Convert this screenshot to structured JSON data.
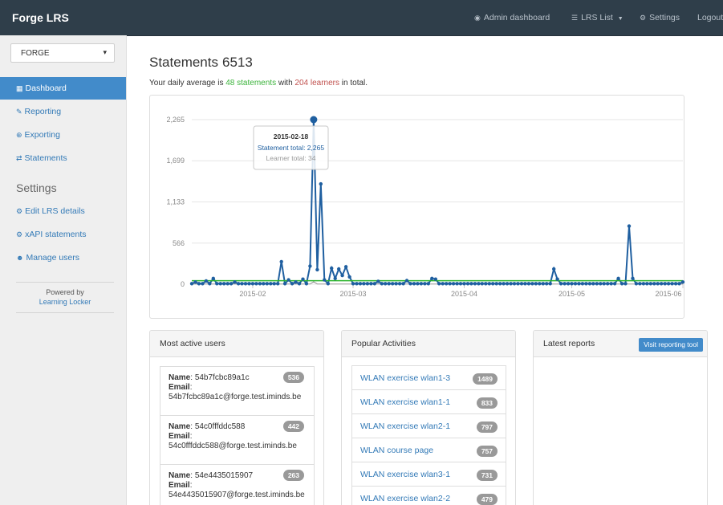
{
  "navbar": {
    "brand": "Forge LRS",
    "admin_dashboard": "Admin dashboard",
    "lrs_list": "LRS List",
    "settings": "Settings",
    "logout": "Logout"
  },
  "sidebar": {
    "lrs_select": "FORGE",
    "items": [
      {
        "label": "Dashboard",
        "icon": "bar-chart-icon"
      },
      {
        "label": "Reporting",
        "icon": "pencil-icon"
      },
      {
        "label": "Exporting",
        "icon": "download-circle-icon"
      },
      {
        "label": "Statements",
        "icon": "transfer-icon"
      }
    ],
    "settings_heading": "Settings",
    "settings_items": [
      {
        "label": "Edit LRS details",
        "icon": "gear-icon"
      },
      {
        "label": "xAPI statements",
        "icon": "gears-icon"
      },
      {
        "label": "Manage users",
        "icon": "users-icon"
      }
    ],
    "powered_by": "Powered by",
    "powered_link": "Learning Locker"
  },
  "main": {
    "title": "Statements",
    "statement_count": "6513",
    "summary": {
      "prefix": "Your daily average is",
      "statements": "48 statements",
      "middle": "with",
      "learners": "204 learners",
      "suffix": "in total."
    }
  },
  "chart_data": {
    "type": "line",
    "y_ticks": [
      "2,265",
      "1,699",
      "1,133",
      "566",
      "0"
    ],
    "x_ticks": [
      "2015-02",
      "2015-03",
      "2015-04",
      "2015-05",
      "2015-06"
    ],
    "ylim": [
      0,
      2265
    ],
    "grid": true,
    "series": [
      {
        "name": "Statement total",
        "color": "#1f5fa0",
        "points": [
          [
            "2015-01-16",
            30
          ],
          [
            "2015-01-19",
            45
          ],
          [
            "2015-01-21",
            80
          ],
          [
            "2015-01-27",
            30
          ],
          [
            "2015-02-09",
            310
          ],
          [
            "2015-02-11",
            60
          ],
          [
            "2015-02-13",
            30
          ],
          [
            "2015-02-15",
            70
          ],
          [
            "2015-02-17",
            250
          ],
          [
            "2015-02-18",
            2265
          ],
          [
            "2015-02-19",
            200
          ],
          [
            "2015-02-20",
            1380
          ],
          [
            "2015-02-21",
            60
          ],
          [
            "2015-02-23",
            220
          ],
          [
            "2015-02-24",
            80
          ],
          [
            "2015-02-25",
            210
          ],
          [
            "2015-02-26",
            120
          ],
          [
            "2015-02-27",
            240
          ],
          [
            "2015-02-28",
            100
          ],
          [
            "2015-03-08",
            40
          ],
          [
            "2015-03-16",
            50
          ],
          [
            "2015-03-23",
            80
          ],
          [
            "2015-03-24",
            70
          ],
          [
            "2015-04-26",
            210
          ],
          [
            "2015-04-27",
            70
          ],
          [
            "2015-05-14",
            80
          ],
          [
            "2015-05-17",
            800
          ],
          [
            "2015-05-18",
            80
          ],
          [
            "2015-06-01",
            30
          ]
        ]
      },
      {
        "name": "Learner total",
        "color": "#999999",
        "points": [
          [
            "2015-02-18",
            34
          ]
        ]
      },
      {
        "name": "Daily average",
        "color": "#2db52d",
        "points": [
          [
            "2015-01-15",
            48
          ],
          [
            "2015-06-01",
            48
          ]
        ]
      }
    ],
    "tooltip": {
      "date": "2015-02-18",
      "statement_label": "Statement total: 2,265",
      "learner_label": "Learner total: 34"
    }
  },
  "panels": {
    "most_active": {
      "title": "Most active users",
      "name_label": "Name",
      "email_label": "Email",
      "users": [
        {
          "name": "54b7fcbc89a1c",
          "email": "54b7fcbc89a1c@forge.test.iminds.be",
          "count": "536"
        },
        {
          "name": "54c0fffddc588",
          "email": "54c0fffddc588@forge.test.iminds.be",
          "count": "442"
        },
        {
          "name": "54e4435015907",
          "email": "54e4435015907@forge.test.iminds.be",
          "count": "263"
        }
      ]
    },
    "popular": {
      "title": "Popular Activities",
      "activities": [
        {
          "label": "WLAN exercise wlan1-3",
          "count": "1489"
        },
        {
          "label": "WLAN exercise wlan1-1",
          "count": "833"
        },
        {
          "label": "WLAN exercise wlan2-1",
          "count": "797"
        },
        {
          "label": "WLAN course page",
          "count": "757"
        },
        {
          "label": "WLAN exercise wlan3-1",
          "count": "731"
        },
        {
          "label": "WLAN exercise wlan2-2",
          "count": "479"
        }
      ]
    },
    "reports": {
      "title": "Latest reports",
      "button": "Visit reporting tool"
    }
  }
}
